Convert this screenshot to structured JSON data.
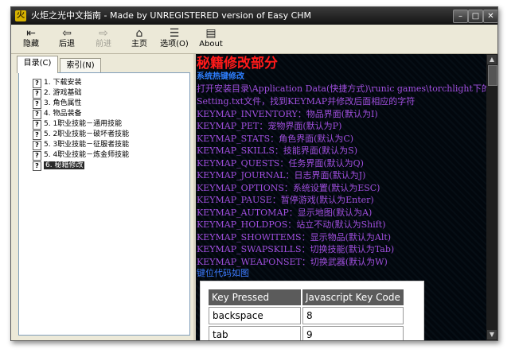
{
  "window": {
    "title": "火炬之光中文指南 - Made by UNREGISTERED version of Easy CHM",
    "minimize_glyph": "–",
    "maximize_glyph": "□",
    "close_glyph": "✕"
  },
  "toolbar": {
    "buttons": [
      {
        "label": "隐藏",
        "icon": "hide-icon",
        "glyph": "⇤",
        "enabled": true
      },
      {
        "label": "后退",
        "icon": "back-arrow-icon",
        "glyph": "⇦",
        "enabled": true
      },
      {
        "label": "前进",
        "icon": "forward-arrow-icon",
        "glyph": "⇨",
        "enabled": false
      },
      {
        "label": "主页",
        "icon": "home-icon",
        "glyph": "⌂",
        "enabled": true
      },
      {
        "label": "选项(O)",
        "icon": "options-icon",
        "glyph": "☰",
        "enabled": true
      },
      {
        "label": "About",
        "icon": "about-icon",
        "glyph": "▤",
        "enabled": true
      }
    ]
  },
  "tabs": [
    {
      "label": "目录(C)",
      "active": true
    },
    {
      "label": "索引(N)",
      "active": false
    }
  ],
  "tree": {
    "help_glyph": "?",
    "items": [
      {
        "label": "1. 下载安装"
      },
      {
        "label": "2. 游戏基础"
      },
      {
        "label": "3. 角色属性"
      },
      {
        "label": "4. 物品装备"
      },
      {
        "label": "5. 1职业技能－通用技能"
      },
      {
        "label": "5. 2职业技能－破坏者技能"
      },
      {
        "label": "5. 3职业技能－征服者技能"
      },
      {
        "label": "5. 4职业技能－炼金师技能"
      },
      {
        "label": "6. 秘籍修改",
        "selected": true
      }
    ]
  },
  "content": {
    "title": "秘籍修改部分",
    "subtitle": "系统热键修改",
    "intro_lines": [
      "打开安装目录\\Application Data(快捷方式)\\runic games\\torchlight下的",
      "Setting.txt文件，找到KEYMAP并修改后面相应的字符"
    ],
    "keymaps": [
      "KEYMAP_INVENTORY：物品界面(默认为I)",
      "KEYMAP_PET：宠物界面(默认为P)",
      "KEYMAP_STATS：角色界面(默认为C)",
      "KEYMAP_SKILLS：技能界面(默认为S)",
      "KEYMAP_QUESTS：任务界面(默认为Q)",
      "KEYMAP_JOURNAL：日志界面(默认为J)",
      "KEYMAP_OPTIONS：系统设置(默认为ESC)",
      "KEYMAP_PAUSE：暂停游戏(默认为Enter)",
      "KEYMAP_AUTOMAP：显示地图(默认为A)",
      "KEYMAP_HOLDPOS：站立不动(默认为Shift)",
      "KEYMAP_SHOWITEMS：显示物品(默认为Alt)",
      "KEYMAP_SWAPSKILLS：切换技能(默认为Tab)",
      "KEYMAP_WEAPONSET：切换武器(默认为W)"
    ],
    "caption": "键位代码如图",
    "key_table": {
      "headers": [
        "Key Pressed",
        "Javascript Key Code"
      ],
      "rows": [
        [
          "backspace",
          "8"
        ],
        [
          "tab",
          "9"
        ]
      ]
    }
  },
  "scrollbar": {
    "up_glyph": "▲",
    "down_glyph": "▼"
  },
  "colors": {
    "title_red": "#ff1a1a",
    "subtitle_blue": "#2e7fff",
    "text_purple": "#a14fe0",
    "content_bg": "#02070d"
  }
}
